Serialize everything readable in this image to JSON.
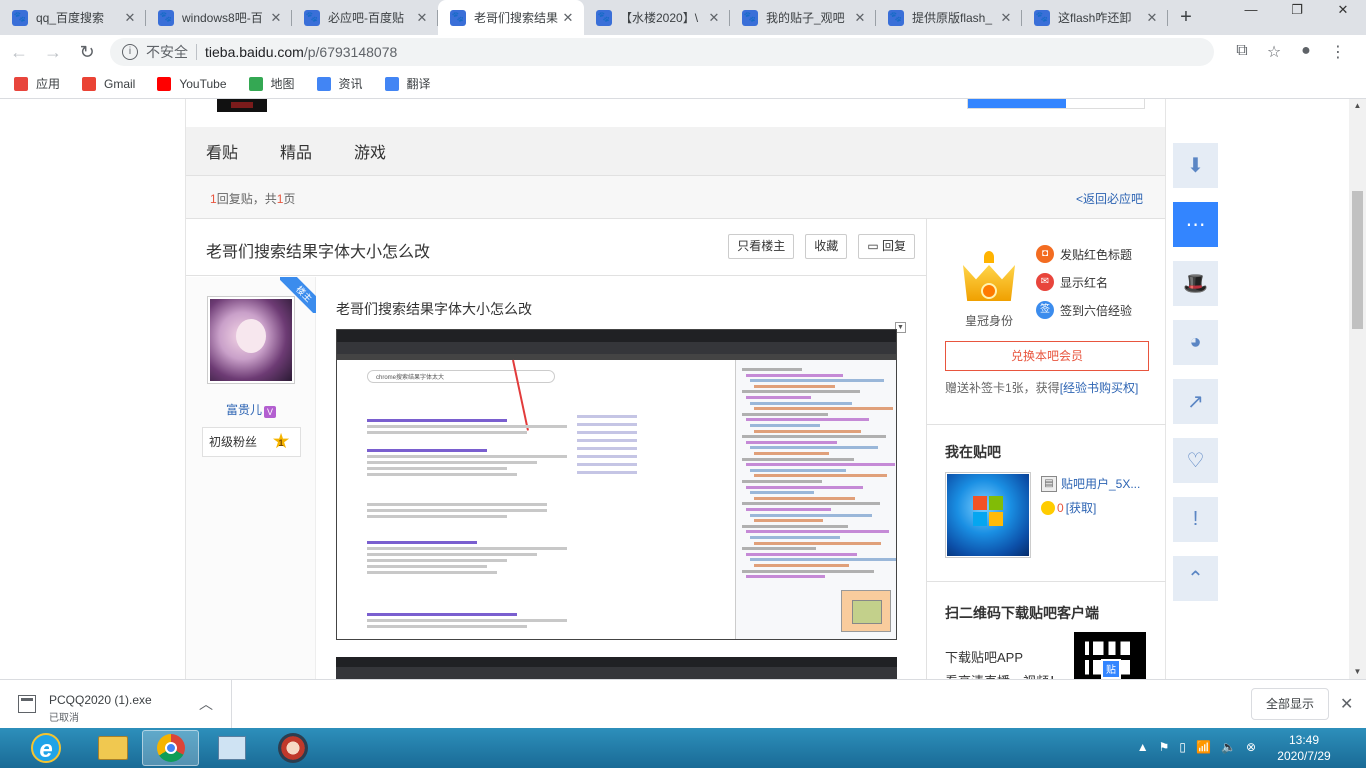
{
  "browser": {
    "tabs": [
      {
        "title": "qq_百度搜索",
        "icon": "paw-icon",
        "active": false
      },
      {
        "title": "windows8吧-百",
        "icon": "paw-icon",
        "active": false
      },
      {
        "title": "必应吧-百度贴",
        "icon": "paw-icon",
        "active": false
      },
      {
        "title": "老哥们搜索结果",
        "icon": "paw-icon",
        "active": true
      },
      {
        "title": "【水楼2020】\\",
        "icon": "paw-icon",
        "active": false
      },
      {
        "title": "我的贴子_观吧",
        "icon": "paw-icon",
        "active": false
      },
      {
        "title": "提供原版flash_",
        "icon": "paw-icon",
        "active": false
      },
      {
        "title": "这flash咋还卸",
        "icon": "paw-icon",
        "active": false
      }
    ],
    "omnibox": {
      "security": "不安全",
      "host": "tieba.baidu.com",
      "path": "/p/6793148078"
    },
    "bookmarks": [
      {
        "label": "应用",
        "icon": "apps-grid-icon",
        "color": "#e8453c"
      },
      {
        "label": "Gmail",
        "icon": "gmail-icon",
        "color": "#ea4335"
      },
      {
        "label": "YouTube",
        "icon": "youtube-icon",
        "color": "#ff0000"
      },
      {
        "label": "地图",
        "icon": "maps-icon",
        "color": "#34a853"
      },
      {
        "label": "资讯",
        "icon": "news-icon",
        "color": "#4285f4"
      },
      {
        "label": "翻译",
        "icon": "translate-icon",
        "color": "#4285f4"
      }
    ]
  },
  "forum": {
    "nav": [
      "看贴",
      "精品",
      "游戏"
    ],
    "reply_count": "1",
    "reply_text_a": "回复贴，共",
    "page_count": "1",
    "reply_text_b": "页",
    "back_link": "<返回必应吧",
    "thread_title": "老哥们搜索结果字体大小怎么改",
    "actions": [
      "只看楼主",
      "收藏",
      "回复"
    ],
    "louzhu_tag": "楼主",
    "author": {
      "name": "富贵儿",
      "badge": "V",
      "level_title": "初级粉丝",
      "level": "1"
    },
    "post_title": "老哥们搜索结果字体大小怎么改",
    "embedded_search_query": "chrome搜索结果字体太大"
  },
  "sidebar": {
    "crown_label": "皇冠身份",
    "features": [
      {
        "label": "发贴红色标题",
        "color": "#f36c21",
        "glyph": "◘"
      },
      {
        "label": "显示红名",
        "color": "#e8453c",
        "glyph": "✉"
      },
      {
        "label": "签到六倍经验",
        "color": "#3b8ced",
        "glyph": "签"
      }
    ],
    "vip_button": "兑换本吧会员",
    "vip_note_a": "赠送补签卡1张，获得",
    "vip_note_link": "[经验书购买权]",
    "in_forum_title": "我在贴吧",
    "user_name": "贴吧用户_5X...",
    "exp_value": "0",
    "exp_link": "[获取]",
    "download_title": "扫二维码下载贴吧客户端",
    "download_text": "下载贴吧APP",
    "download_sub": "看高清直播、视频！",
    "qr_badge": "贴"
  },
  "tools": [
    "download-app-icon",
    "message-icon",
    "magic-hat-icon",
    "bear-icon",
    "share-icon",
    "favorite-heart-icon",
    "report-icon",
    "back-to-top-icon"
  ],
  "downloads": {
    "file": "PCQQ2020 (1).exe",
    "status": "已取消",
    "show_all": "全部显示"
  },
  "taskbar": {
    "time": "13:49",
    "date": "2020/7/29"
  }
}
